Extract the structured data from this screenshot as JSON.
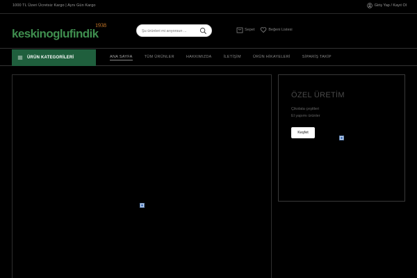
{
  "topbar": {
    "promo_text": "1000 TL Üzeri Ücretsiz Kargo | Aynı Gün Kargo",
    "login_text": "Giriş Yap / Kayıt Ol"
  },
  "header": {
    "logo_text": "keskinoglufindik",
    "logo_year": "1938",
    "search_placeholder": "Şu ürünleri mi arıyorsun ...",
    "cart_label": "Sepet",
    "wishlist_label": "Beğeni Listesi"
  },
  "nav": {
    "categories_label": "ÜRÜN KATEGORİLERİ",
    "links": [
      "ANA SAYFA",
      "TÜM ÜRÜNLER",
      "HAKKIMIZDA",
      "İLETİŞİM",
      "ÜRÜN HİKAYELERİ",
      "SİPARİŞ TAKİP"
    ]
  },
  "promo_card": {
    "title": "ÖZEL ÜRETİM",
    "line1": "Çikolata çeşitleri",
    "line2": "El yapımı ürünler",
    "button_label": "Keşfet"
  },
  "colors": {
    "background": "#000000",
    "brand_green": "#1f5f3d",
    "logo_orange": "#d9822b"
  }
}
